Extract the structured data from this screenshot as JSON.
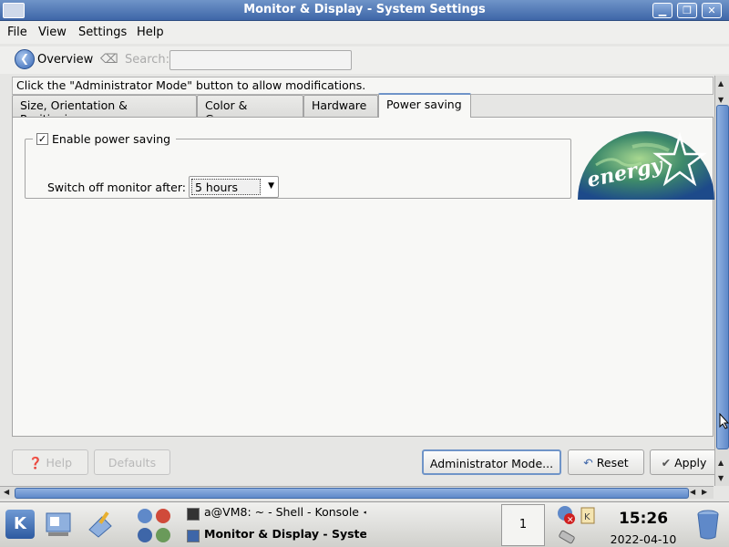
{
  "window": {
    "title": "Monitor & Display - System Settings"
  },
  "menubar": {
    "file": "File",
    "view": "View",
    "settings": "Settings",
    "help": "Help"
  },
  "toolbar": {
    "overview": "Overview",
    "search_label": "Search:",
    "search_value": ""
  },
  "info": {
    "message": "Click the \"Administrator Mode\" button to allow modifications."
  },
  "tabs": [
    {
      "label": "Size, Orientation & Positioning",
      "active": false
    },
    {
      "label": "Color & Gamma",
      "active": false
    },
    {
      "label": "Hardware",
      "active": false
    },
    {
      "label": "Power saving",
      "active": true
    }
  ],
  "power": {
    "enable_label": "Enable power saving",
    "enabled": true,
    "switch_off_label": "Switch off monitor after:",
    "switch_off_value": "5 hours",
    "logo_text": "energy"
  },
  "buttons": {
    "help": "Help",
    "defaults": "Defaults",
    "admin": "Administrator Mode...",
    "reset": "Reset",
    "apply": "Apply"
  },
  "taskbar": {
    "task1": "a@VM8: ~ - Shell - Konsole <",
    "task2": "Monitor & Display - Syste",
    "desktop_number": "1",
    "time": "15:26",
    "date": "2022-04-10"
  },
  "colors": {
    "accent": "#6f94c8",
    "title_bar": "#3e66a8"
  }
}
